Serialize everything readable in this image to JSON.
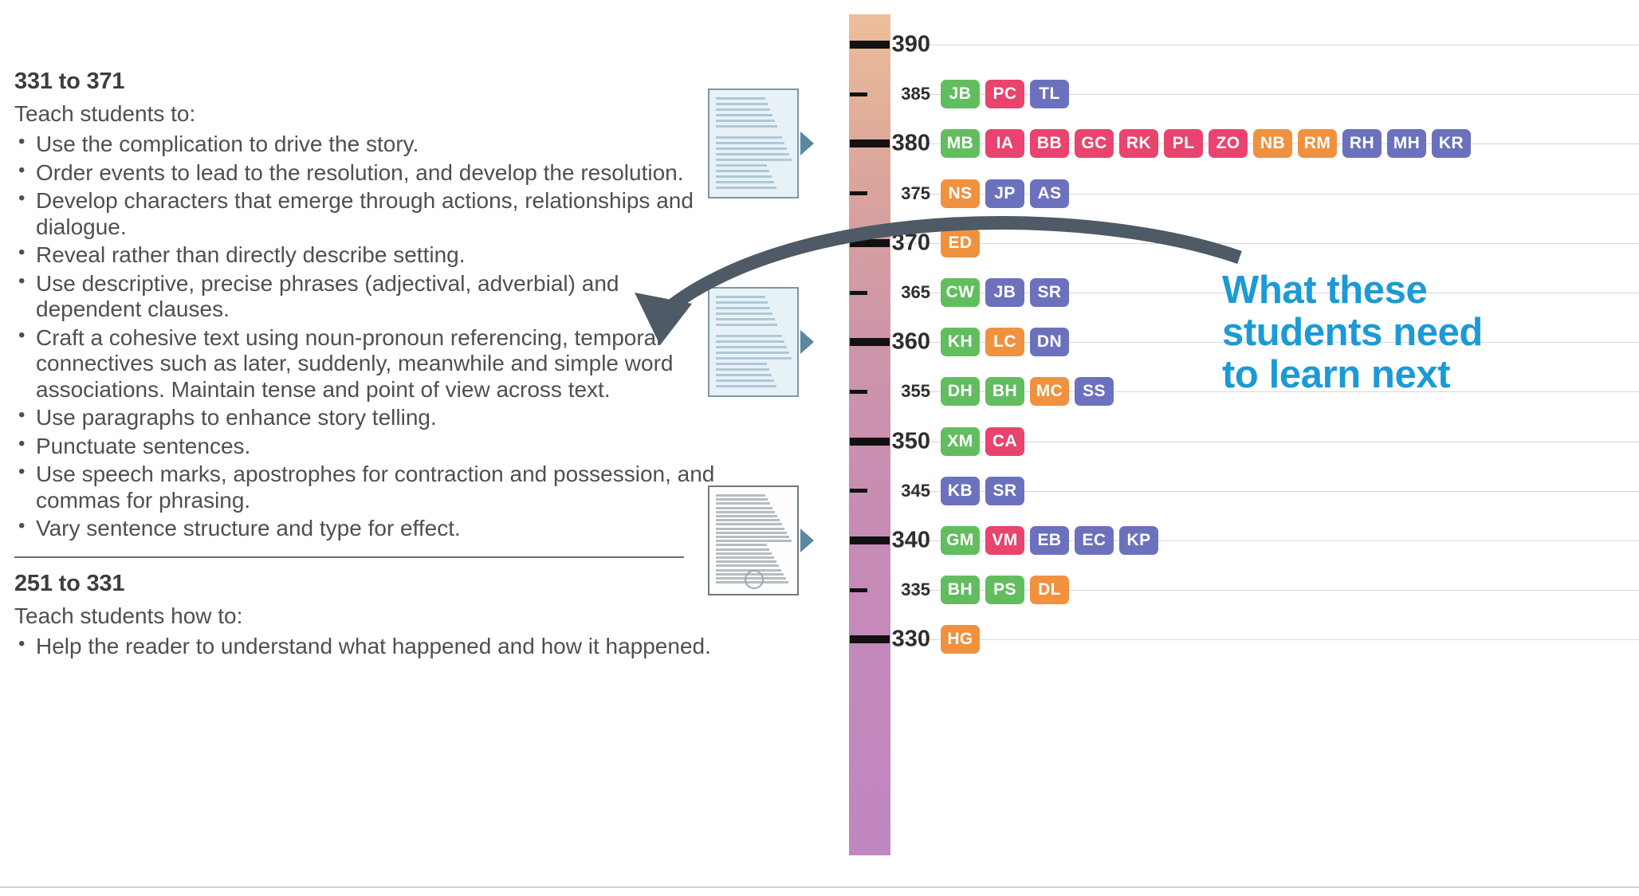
{
  "left_panel": {
    "sections": [
      {
        "title": "331 to 371",
        "lead": "Teach students to:",
        "items": [
          "Use the complication to drive the story.",
          "Order events to lead to the resolution, and develop the resolution.",
          "Develop characters that emerge through actions, relationships and dialogue.",
          "Reveal rather than directly describe setting.",
          "Use descriptive, precise phrases (adjectival, adverbial) and dependent clauses.",
          "Craft a cohesive text using noun-pronoun referencing, temporal connectives such as later, suddenly, meanwhile and simple word associations. Maintain tense and point of view across text.",
          "Use paragraphs to enhance story telling.",
          "Punctuate sentences.",
          "Use speech marks, apostrophes for contraction and possession, and commas for phrasing.",
          "Vary sentence structure and type for effect."
        ]
      },
      {
        "title": "251 to 331",
        "lead": "Teach students how to:",
        "items": [
          "Help the reader to understand what happened and how it happened."
        ]
      }
    ]
  },
  "callout": {
    "line1": "What these",
    "line2": "students need",
    "line3": "to learn next",
    "color": "#1b9ad6"
  },
  "chart_data": {
    "type": "scatter",
    "title": "",
    "xlabel": "",
    "ylabel": "",
    "ylim": [
      328,
      392
    ],
    "grid": true,
    "axis_ticks_major": [
      390,
      380,
      370,
      360,
      350,
      340,
      330
    ],
    "axis_ticks_minor": [
      385,
      375,
      365,
      355,
      345,
      335
    ],
    "legend_position": "none",
    "rows": [
      {
        "score": 390,
        "major": true,
        "students": []
      },
      {
        "score": 385,
        "major": false,
        "students": [
          {
            "initials": "JB",
            "color": "green"
          },
          {
            "initials": "PC",
            "color": "pink"
          },
          {
            "initials": "TL",
            "color": "purple"
          }
        ]
      },
      {
        "score": 380,
        "major": true,
        "students": [
          {
            "initials": "MB",
            "color": "green"
          },
          {
            "initials": "IA",
            "color": "pink"
          },
          {
            "initials": "BB",
            "color": "pink"
          },
          {
            "initials": "GC",
            "color": "pink"
          },
          {
            "initials": "RK",
            "color": "pink"
          },
          {
            "initials": "PL",
            "color": "pink"
          },
          {
            "initials": "ZO",
            "color": "pink"
          },
          {
            "initials": "NB",
            "color": "orange"
          },
          {
            "initials": "RM",
            "color": "orange"
          },
          {
            "initials": "RH",
            "color": "purple"
          },
          {
            "initials": "MH",
            "color": "purple"
          },
          {
            "initials": "KR",
            "color": "purple"
          }
        ]
      },
      {
        "score": 375,
        "major": false,
        "students": [
          {
            "initials": "NS",
            "color": "orange"
          },
          {
            "initials": "JP",
            "color": "purple"
          },
          {
            "initials": "AS",
            "color": "purple"
          }
        ]
      },
      {
        "score": 370,
        "major": true,
        "students": [
          {
            "initials": "ED",
            "color": "orange"
          }
        ]
      },
      {
        "score": 365,
        "major": false,
        "students": [
          {
            "initials": "CW",
            "color": "green"
          },
          {
            "initials": "JB",
            "color": "purple"
          },
          {
            "initials": "SR",
            "color": "purple"
          }
        ]
      },
      {
        "score": 360,
        "major": true,
        "students": [
          {
            "initials": "KH",
            "color": "green"
          },
          {
            "initials": "LC",
            "color": "orange"
          },
          {
            "initials": "DN",
            "color": "purple"
          }
        ]
      },
      {
        "score": 355,
        "major": false,
        "students": [
          {
            "initials": "DH",
            "color": "green"
          },
          {
            "initials": "BH",
            "color": "green"
          },
          {
            "initials": "MC",
            "color": "orange"
          },
          {
            "initials": "SS",
            "color": "purple"
          }
        ]
      },
      {
        "score": 350,
        "major": true,
        "students": [
          {
            "initials": "XM",
            "color": "green"
          },
          {
            "initials": "CA",
            "color": "pink"
          }
        ]
      },
      {
        "score": 345,
        "major": false,
        "students": [
          {
            "initials": "KB",
            "color": "purple"
          },
          {
            "initials": "SR",
            "color": "purple"
          }
        ]
      },
      {
        "score": 340,
        "major": true,
        "students": [
          {
            "initials": "GM",
            "color": "green"
          },
          {
            "initials": "VM",
            "color": "pink"
          },
          {
            "initials": "EB",
            "color": "purple"
          },
          {
            "initials": "EC",
            "color": "purple"
          },
          {
            "initials": "KP",
            "color": "purple"
          }
        ]
      },
      {
        "score": 335,
        "major": false,
        "students": [
          {
            "initials": "BH",
            "color": "green"
          },
          {
            "initials": "PS",
            "color": "green"
          },
          {
            "initials": "DL",
            "color": "orange"
          }
        ]
      },
      {
        "score": 330,
        "major": true,
        "students": [
          {
            "initials": "HG",
            "color": "orange"
          }
        ]
      }
    ],
    "badge_colors": {
      "green": "#62bd5f",
      "pink": "#e8446d",
      "purple": "#6c71bd",
      "orange": "#f0913f"
    },
    "spine_gradient": {
      "top": "#edbe9b",
      "bottom": "#bf86bf"
    },
    "exemplar_thumbnails": [
      {
        "anchor_score": 380,
        "style": "blue-lined"
      },
      {
        "anchor_score": 360,
        "style": "blue-lined"
      },
      {
        "anchor_score": 340,
        "style": "grey-dense"
      }
    ]
  }
}
